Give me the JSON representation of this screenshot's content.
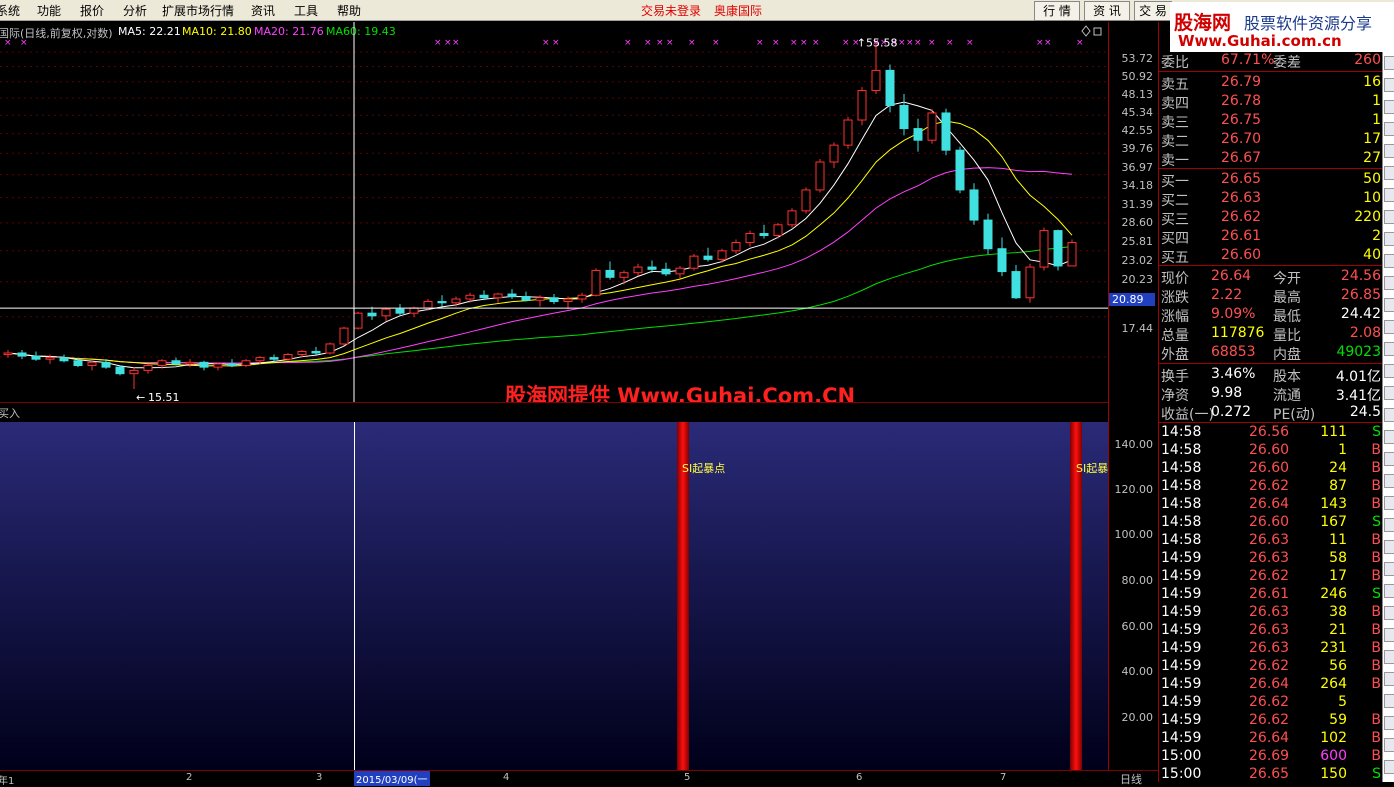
{
  "menu": {
    "items": [
      "系统",
      "功能",
      "报价",
      "分析",
      "扩展市场行情",
      "资讯",
      "工具",
      "帮助"
    ],
    "trade_status": "交易未登录",
    "stock_name": "奥康国际",
    "tabs": [
      "行 情",
      "资 讯",
      "交 易"
    ]
  },
  "logo": {
    "brand": "股海网",
    "slogan": "股票软件资源分享",
    "url": "Www.Guhai.com.cn"
  },
  "chart_header": {
    "title": "国际(日线,前复权,对数)",
    "ma5": "MA5: 22.21",
    "ma10": "MA10: 21.80",
    "ma20": "MA20: 21.76",
    "ma60": "MA60: 19.43",
    "ma5_color": "#ffffff",
    "ma10_color": "#ffff00",
    "ma20_color": "#ff40ff",
    "ma60_color": "#00e000",
    "high_label": "55.58",
    "low_label": "15.51",
    "cursor_price": "20.89"
  },
  "price_axis": [
    "53.72",
    "50.92",
    "48.13",
    "45.34",
    "42.55",
    "39.76",
    "36.97",
    "34.18",
    "31.39",
    "28.60",
    "25.81",
    "23.02",
    "20.23",
    "17.44"
  ],
  "indicator": {
    "name": "买入",
    "signal_label": "SI起暴点",
    "signal_label_cut": "SI起暴",
    "axis": [
      "140.00",
      "120.00",
      "100.00",
      "80.00",
      "60.00",
      "40.00",
      "20.00"
    ]
  },
  "watermark": "股海网提供 Www.Guhai.Com.CN",
  "bottom_axis": {
    "labels": [
      "年1",
      "2",
      "3",
      "2015/03/09(一",
      "4",
      "5",
      "6",
      "7"
    ],
    "period": "日线"
  },
  "quote": {
    "webi_label": "委比",
    "webi": "67.71%",
    "weicha_label": "委差",
    "weicha": "260",
    "asks": [
      {
        "label": "卖五",
        "price": "26.79",
        "vol": "16"
      },
      {
        "label": "卖四",
        "price": "26.78",
        "vol": "1"
      },
      {
        "label": "卖三",
        "price": "26.75",
        "vol": "1"
      },
      {
        "label": "卖二",
        "price": "26.70",
        "vol": "17"
      },
      {
        "label": "卖一",
        "price": "26.67",
        "vol": "27"
      }
    ],
    "bids": [
      {
        "label": "买一",
        "price": "26.65",
        "vol": "50"
      },
      {
        "label": "买二",
        "price": "26.63",
        "vol": "10"
      },
      {
        "label": "买三",
        "price": "26.62",
        "vol": "220"
      },
      {
        "label": "买四",
        "price": "26.61",
        "vol": "2"
      },
      {
        "label": "买五",
        "price": "26.60",
        "vol": "40"
      }
    ],
    "stats": [
      {
        "l1": "现价",
        "v1": "26.64",
        "l2": "今开",
        "v2": "24.56"
      },
      {
        "l1": "涨跌",
        "v1": "2.22",
        "l2": "最高",
        "v2": "26.85"
      },
      {
        "l1": "涨幅",
        "v1": "9.09%",
        "l2": "最低",
        "v2": "24.42"
      },
      {
        "l1": "总量",
        "v1": "117876",
        "l2": "量比",
        "v2": "2.08"
      },
      {
        "l1": "外盘",
        "v1": "68853",
        "l2": "内盘",
        "v2": "49023"
      }
    ],
    "stats2": [
      {
        "l1": "换手",
        "v1": "3.46%",
        "l2": "股本",
        "v2": "4.01亿"
      },
      {
        "l1": "净资",
        "v1": "9.98",
        "l2": "流通",
        "v2": "3.41亿"
      },
      {
        "l1": "收益(一)",
        "v1": "0.272",
        "l2": "PE(动)",
        "v2": "24.5"
      }
    ],
    "ticks": [
      {
        "t": "14:58",
        "p": "26.56",
        "v": "111",
        "s": "S"
      },
      {
        "t": "14:58",
        "p": "26.60",
        "v": "1",
        "s": "B"
      },
      {
        "t": "14:58",
        "p": "26.60",
        "v": "24",
        "s": "B"
      },
      {
        "t": "14:58",
        "p": "26.62",
        "v": "87",
        "s": "B"
      },
      {
        "t": "14:58",
        "p": "26.64",
        "v": "143",
        "s": "B"
      },
      {
        "t": "14:58",
        "p": "26.60",
        "v": "167",
        "s": "S"
      },
      {
        "t": "14:58",
        "p": "26.63",
        "v": "11",
        "s": "B"
      },
      {
        "t": "14:59",
        "p": "26.63",
        "v": "58",
        "s": "B"
      },
      {
        "t": "14:59",
        "p": "26.62",
        "v": "17",
        "s": "B"
      },
      {
        "t": "14:59",
        "p": "26.61",
        "v": "246",
        "s": "S"
      },
      {
        "t": "14:59",
        "p": "26.63",
        "v": "38",
        "s": "B"
      },
      {
        "t": "14:59",
        "p": "26.63",
        "v": "21",
        "s": "B"
      },
      {
        "t": "14:59",
        "p": "26.63",
        "v": "231",
        "s": "B"
      },
      {
        "t": "14:59",
        "p": "26.62",
        "v": "56",
        "s": "B"
      },
      {
        "t": "14:59",
        "p": "26.64",
        "v": "264",
        "s": "B"
      },
      {
        "t": "14:59",
        "p": "26.62",
        "v": "5",
        "s": ""
      },
      {
        "t": "14:59",
        "p": "26.62",
        "v": "59",
        "s": "B"
      },
      {
        "t": "14:59",
        "p": "26.64",
        "v": "102",
        "s": "B"
      },
      {
        "t": "15:00",
        "p": "26.69",
        "v": "600",
        "s": "B"
      },
      {
        "t": "15:00",
        "p": "26.65",
        "v": "150",
        "s": "S"
      }
    ]
  },
  "candles": [
    [
      0.0,
      17.6,
      17.9,
      17.4,
      17.7
    ],
    [
      1.0,
      17.7,
      17.9,
      17.3,
      17.5
    ],
    [
      2.0,
      17.5,
      17.8,
      17.2,
      17.3
    ],
    [
      3.0,
      17.3,
      17.6,
      17.0,
      17.4
    ],
    [
      4.0,
      17.4,
      17.6,
      17.1,
      17.2
    ],
    [
      5.0,
      17.2,
      17.4,
      16.8,
      16.9
    ],
    [
      6.0,
      16.9,
      17.2,
      16.6,
      17.1
    ],
    [
      7.0,
      17.1,
      17.3,
      16.7,
      16.8
    ],
    [
      8.0,
      16.8,
      16.9,
      16.3,
      16.4
    ],
    [
      9.0,
      16.4,
      16.8,
      15.5,
      16.6
    ],
    [
      10.0,
      16.6,
      17.0,
      16.4,
      16.9
    ],
    [
      11.0,
      16.9,
      17.3,
      16.7,
      17.2
    ],
    [
      12.0,
      17.2,
      17.4,
      16.9,
      17.0
    ],
    [
      13.0,
      17.0,
      17.3,
      16.8,
      17.1
    ],
    [
      14.0,
      17.1,
      17.2,
      16.6,
      16.8
    ],
    [
      15.0,
      16.8,
      17.1,
      16.6,
      17.0
    ],
    [
      16.0,
      17.0,
      17.3,
      16.8,
      16.9
    ],
    [
      17.0,
      16.9,
      17.3,
      16.8,
      17.2
    ],
    [
      18.0,
      17.2,
      17.5,
      17.0,
      17.4
    ],
    [
      19.0,
      17.4,
      17.6,
      17.1,
      17.3
    ],
    [
      20.0,
      17.3,
      17.7,
      17.2,
      17.6
    ],
    [
      21.0,
      17.6,
      17.9,
      17.4,
      17.8
    ],
    [
      22.0,
      17.8,
      18.1,
      17.5,
      17.7
    ],
    [
      23.0,
      17.7,
      18.4,
      17.6,
      18.3
    ],
    [
      24.0,
      18.3,
      19.5,
      18.2,
      19.4
    ],
    [
      25.0,
      19.4,
      20.6,
      19.3,
      20.5
    ],
    [
      26.0,
      20.5,
      21.0,
      20.0,
      20.3
    ],
    [
      27.0,
      20.3,
      20.9,
      19.9,
      20.8
    ],
    [
      28.0,
      20.8,
      21.2,
      20.3,
      20.5
    ],
    [
      29.0,
      20.5,
      21.0,
      20.2,
      20.9
    ],
    [
      30.0,
      20.9,
      21.6,
      20.7,
      21.4
    ],
    [
      31.0,
      21.4,
      21.9,
      21.0,
      21.3
    ],
    [
      32.0,
      21.3,
      21.8,
      21.0,
      21.6
    ],
    [
      33.0,
      21.6,
      22.1,
      21.3,
      21.9
    ],
    [
      34.0,
      21.9,
      22.3,
      21.5,
      21.7
    ],
    [
      35.0,
      21.7,
      22.1,
      21.3,
      22.0
    ],
    [
      36.0,
      22.0,
      22.4,
      21.6,
      21.8
    ],
    [
      37.0,
      21.8,
      22.2,
      21.4,
      21.5
    ],
    [
      38.0,
      21.5,
      21.9,
      21.0,
      21.7
    ],
    [
      39.0,
      21.7,
      22.0,
      21.2,
      21.4
    ],
    [
      40.0,
      21.4,
      21.8,
      20.8,
      21.6
    ],
    [
      41.0,
      21.6,
      22.1,
      21.3,
      21.9
    ],
    [
      42.0,
      21.9,
      24.2,
      21.8,
      24.0
    ],
    [
      43.0,
      24.0,
      24.8,
      23.2,
      23.4
    ],
    [
      44.0,
      23.4,
      24.0,
      22.8,
      23.8
    ],
    [
      45.0,
      23.8,
      24.6,
      23.5,
      24.3
    ],
    [
      46.0,
      24.3,
      24.9,
      23.8,
      24.1
    ],
    [
      47.0,
      24.1,
      24.7,
      23.5,
      23.7
    ],
    [
      48.0,
      23.7,
      24.4,
      23.3,
      24.2
    ],
    [
      49.0,
      24.2,
      25.5,
      24.0,
      25.3
    ],
    [
      50.0,
      25.3,
      26.1,
      24.8,
      25.0
    ],
    [
      51.0,
      25.0,
      26.0,
      24.7,
      25.8
    ],
    [
      52.0,
      25.8,
      26.9,
      25.5,
      26.6
    ],
    [
      53.0,
      26.6,
      27.8,
      26.2,
      27.5
    ],
    [
      54.0,
      27.5,
      28.4,
      27.0,
      27.3
    ],
    [
      55.0,
      27.3,
      28.6,
      27.0,
      28.4
    ],
    [
      56.0,
      28.4,
      30.2,
      28.1,
      29.9
    ],
    [
      57.0,
      29.9,
      32.6,
      29.6,
      32.3
    ],
    [
      58.0,
      32.3,
      36.2,
      32.0,
      35.8
    ],
    [
      59.0,
      35.8,
      38.5,
      35.0,
      38.1
    ],
    [
      60.0,
      38.1,
      42.3,
      37.6,
      41.8
    ],
    [
      61.0,
      41.8,
      47.2,
      41.0,
      46.6
    ],
    [
      62.0,
      46.6,
      55.6,
      46.0,
      50.2
    ],
    [
      63.0,
      50.2,
      51.3,
      43.0,
      44.1
    ],
    [
      64.0,
      44.1,
      46.0,
      39.5,
      40.5
    ],
    [
      65.0,
      40.5,
      42.0,
      37.2,
      38.8
    ],
    [
      66.0,
      38.8,
      43.5,
      38.3,
      42.9
    ],
    [
      67.0,
      42.9,
      43.6,
      36.7,
      37.4
    ],
    [
      68.0,
      37.4,
      37.9,
      31.9,
      32.3
    ],
    [
      69.0,
      32.3,
      33.1,
      28.4,
      28.9
    ],
    [
      70.0,
      28.9,
      29.6,
      25.5,
      26.0
    ],
    [
      71.0,
      26.0,
      27.1,
      23.5,
      23.9
    ],
    [
      72.0,
      23.9,
      24.5,
      21.6,
      21.7
    ],
    [
      73.0,
      21.7,
      24.6,
      21.3,
      24.3
    ],
    [
      74.0,
      24.3,
      28.1,
      24.0,
      27.8
    ],
    [
      75.0,
      27.8,
      27.9,
      24.0,
      24.4
    ],
    [
      76.0,
      24.4,
      26.9,
      24.4,
      26.6
    ]
  ]
}
